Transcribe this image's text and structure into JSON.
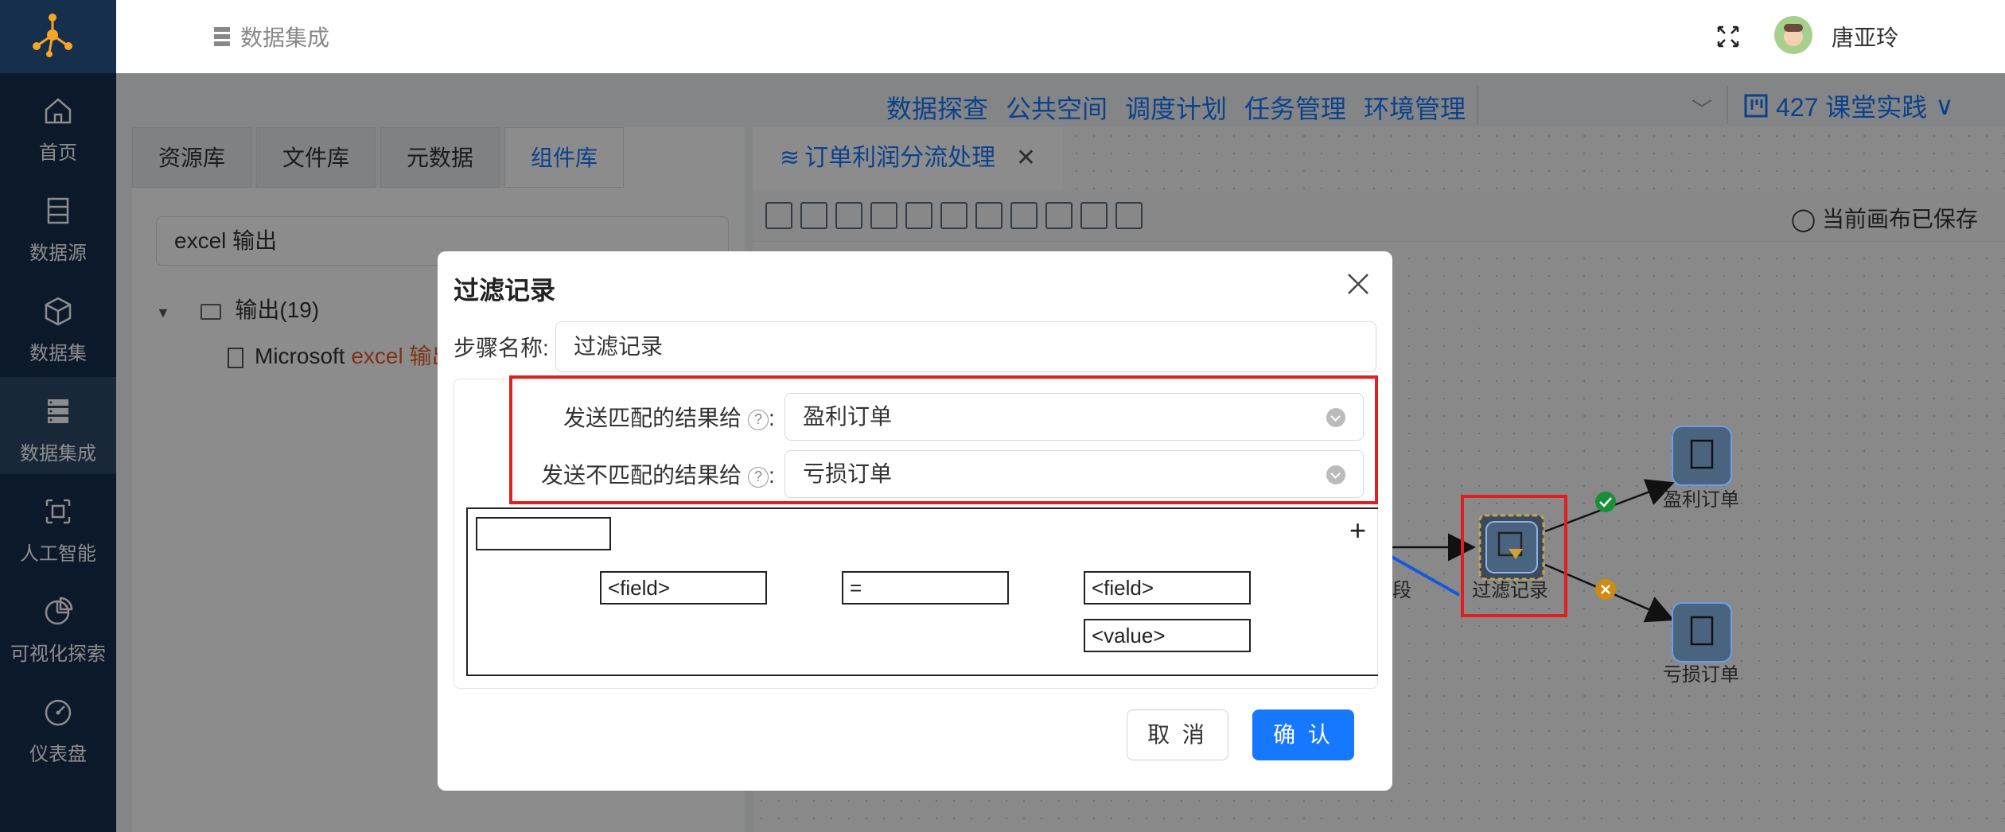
{
  "sidebar": {
    "items": [
      {
        "label": "首页",
        "icon": "home-icon"
      },
      {
        "label": "数据源",
        "icon": "database-icon"
      },
      {
        "label": "数据集",
        "icon": "cube-icon"
      },
      {
        "label": "数据集成",
        "icon": "integration-icon",
        "active": true
      },
      {
        "label": "人工智能",
        "icon": "ai-icon"
      },
      {
        "label": "可视化探索",
        "icon": "pie-chart-icon"
      },
      {
        "label": "仪表盘",
        "icon": "dashboard-icon"
      }
    ]
  },
  "topbar": {
    "breadcrumb": "数据集成",
    "username": "唐亚玲"
  },
  "top_menu": [
    "数据探查",
    "公共空间",
    "调度计划",
    "任务管理",
    "环境管理"
  ],
  "project": "427 课堂实践",
  "left_panel": {
    "tabs": [
      "资源库",
      "文件库",
      "元数据",
      "组件库"
    ],
    "active_tab": "组件库",
    "search_value": "excel 输出",
    "tree": {
      "folder": "输出(19)",
      "item_prefix": "Microsoft ",
      "item_highlight": "excel 输出"
    }
  },
  "canvas": {
    "tab_title": "订单利润分流处理",
    "saved_status": "当前画布已保存",
    "nodes": {
      "filter": "过滤记录",
      "profit": "盈利订单",
      "loss": "亏损订单",
      "prev_partial": "段"
    }
  },
  "modal": {
    "title": "过滤记录",
    "step_name_label": "步骤名称:",
    "step_name_value": "过滤记录",
    "match_label": "发送匹配的结果给",
    "match_value": "盈利订单",
    "nomatch_label": "发送不匹配的结果给",
    "nomatch_value": "亏损订单",
    "help_glyph": "?",
    "colon": ":",
    "condition": {
      "field1": "<field>",
      "operator": "=",
      "field2": "<field>",
      "value": "<value>",
      "add": "+"
    },
    "cancel": "取 消",
    "ok": "确 认"
  },
  "colors": {
    "sidebar_bg": "#162f4d",
    "accent": "#1677ff",
    "highlight_frame": "#e02020",
    "success": "#1fa34a",
    "fail": "#e8a020"
  }
}
